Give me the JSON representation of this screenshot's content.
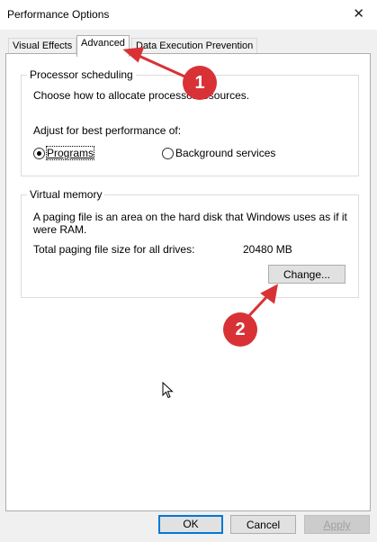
{
  "window": {
    "title": "Performance Options",
    "close_glyph": "✕"
  },
  "tabs": [
    {
      "label": "Visual Effects"
    },
    {
      "label": "Advanced"
    },
    {
      "label": "Data Execution Prevention"
    }
  ],
  "processor": {
    "title": "Processor scheduling",
    "description": "Choose how to allocate processor resources.",
    "adjust_label": "Adjust for best performance of:",
    "programs_label": "Programs",
    "background_label": "Background services",
    "selected": "Programs"
  },
  "virtual_memory": {
    "title": "Virtual memory",
    "description_line1": "A paging file is an area on the hard disk that Windows uses as if it",
    "description_line2": "were RAM.",
    "total_label": "Total paging file size for all drives:",
    "total_value": "20480 MB",
    "change_button": "Change..."
  },
  "buttons": {
    "ok": "OK",
    "cancel": "Cancel",
    "apply": "Apply"
  },
  "annotations": [
    {
      "number": "1",
      "color": "#d93236"
    },
    {
      "number": "2",
      "color": "#d93236"
    }
  ]
}
